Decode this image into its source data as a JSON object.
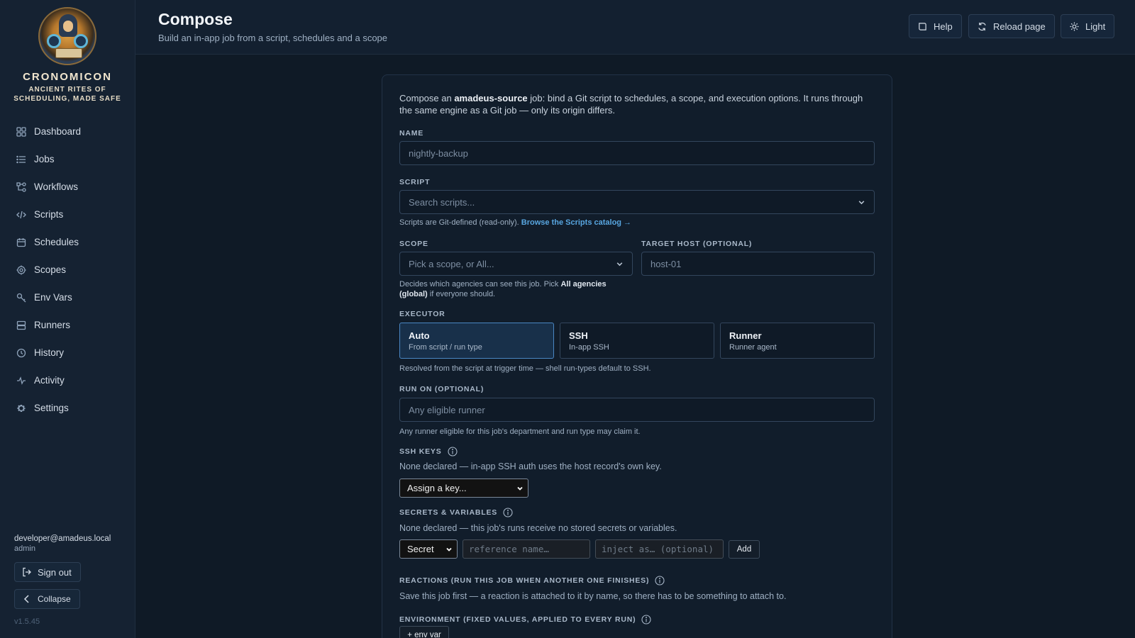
{
  "brand": {
    "name": "CRONOMICON",
    "tagline_line1": "ANCIENT RITES OF",
    "tagline_line2": "SCHEDULING, MADE SAFE"
  },
  "sidebar": {
    "items": [
      {
        "label": "Dashboard",
        "icon": "grid-icon"
      },
      {
        "label": "Jobs",
        "icon": "list-icon"
      },
      {
        "label": "Workflows",
        "icon": "workflow-icon"
      },
      {
        "label": "Scripts",
        "icon": "code-icon"
      },
      {
        "label": "Schedules",
        "icon": "calendar-icon"
      },
      {
        "label": "Scopes",
        "icon": "target-icon"
      },
      {
        "label": "Env Vars",
        "icon": "key-icon"
      },
      {
        "label": "Runners",
        "icon": "server-icon"
      },
      {
        "label": "History",
        "icon": "clock-icon"
      },
      {
        "label": "Activity",
        "icon": "activity-icon"
      },
      {
        "label": "Settings",
        "icon": "gear-icon"
      }
    ],
    "user_email": "developer@amadeus.local",
    "user_role": "admin",
    "sign_out": "Sign out",
    "collapse": "Collapse",
    "version": "v1.5.45"
  },
  "header": {
    "title": "Compose",
    "subtitle": "Build an in-app job from a script, schedules and a scope",
    "help": "Help",
    "reload": "Reload page",
    "theme": "Light"
  },
  "form": {
    "intro_pre": "Compose an ",
    "intro_bold": "amadeus-source",
    "intro_post": " job: bind a Git script to schedules, a scope, and execution options. It runs through the same engine as a Git job — only its origin differs.",
    "name_label": "NAME",
    "name_placeholder": "nightly-backup",
    "script_label": "SCRIPT",
    "script_placeholder": "Search scripts...",
    "script_help": "Scripts are Git-defined (read-only).",
    "script_link": "Browse the Scripts catalog →",
    "scope_label": "SCOPE",
    "scope_placeholder": "Pick a scope, or All...",
    "scope_help_pre": "Decides which agencies can see this job. Pick",
    "scope_help_bold1": "All agencies",
    "scope_help_bold2": "(global)",
    "scope_help_post": "if everyone should.",
    "target_label": "TARGET HOST (OPTIONAL)",
    "target_placeholder": "host-01",
    "executor_label": "EXECUTOR",
    "executors": [
      {
        "title": "Auto",
        "sub": "From script / run type"
      },
      {
        "title": "SSH",
        "sub": "In-app SSH"
      },
      {
        "title": "Runner",
        "sub": "Runner agent"
      }
    ],
    "executor_help": "Resolved from the script at trigger time — shell run-types default to SSH.",
    "runon_label": "RUN ON (OPTIONAL)",
    "runon_placeholder": "Any eligible runner",
    "runon_help": "Any runner eligible for this job's department and run type may claim it.",
    "ssh_label": "SSH KEYS",
    "ssh_text": "None declared — in-app SSH auth uses the host record's own key.",
    "ssh_select": "Assign a key...",
    "secrets_label": "SECRETS & VARIABLES",
    "secrets_text": "None declared — this job's runs receive no stored secrets or variables.",
    "secrets_type": "Secret",
    "secrets_ref_placeholder": "reference name…",
    "secrets_inject_placeholder": "inject as… (optional)",
    "secrets_add": "Add",
    "reactions_label": "REACTIONS (RUN THIS JOB WHEN ANOTHER ONE FINISHES)",
    "reactions_text": "Save this job first — a reaction is attached to it by name, so there has to be something to attach to.",
    "env_label": "ENVIRONMENT (FIXED VALUES, APPLIED TO EVERY RUN)",
    "env_add": "+ env var"
  }
}
